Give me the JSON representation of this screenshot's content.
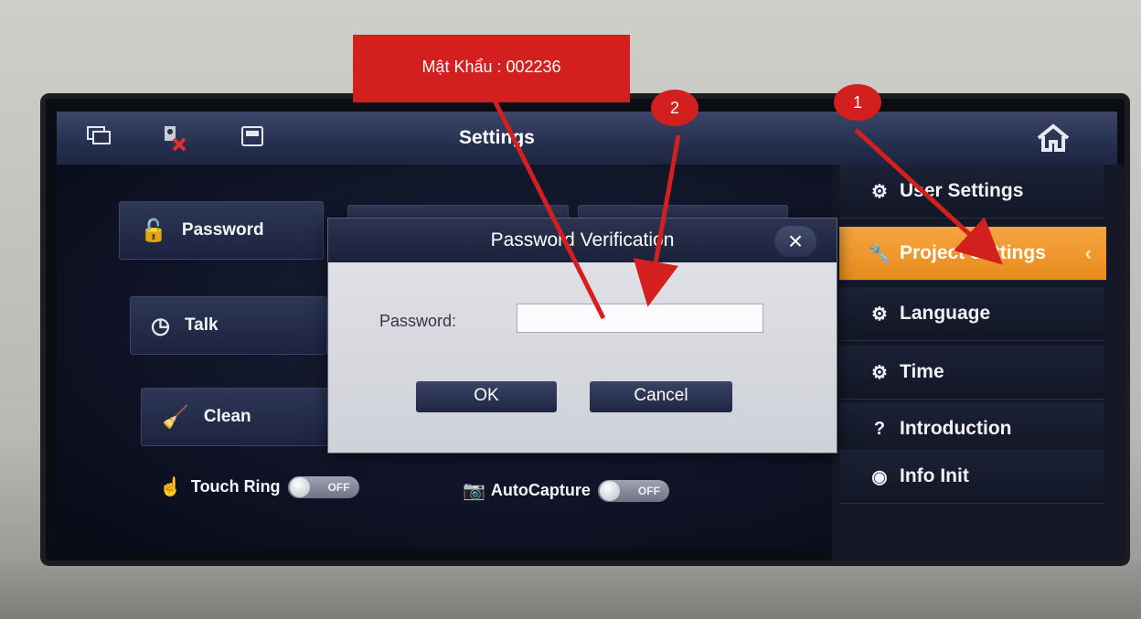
{
  "annotations": {
    "callout_text": "Mật Khẩu : 002236",
    "badge_1": "1",
    "badge_2": "2",
    "arrow_color": "#d41f1f"
  },
  "titlebar": {
    "title": "Settings",
    "icons": [
      "monitor-icon",
      "camera-offline-icon",
      "sd-card-icon",
      "home-icon"
    ]
  },
  "menu": {
    "password_label": "Password",
    "talk_label": "Talk",
    "clean_label": "Clean",
    "touch_ring_label": "Touch Ring",
    "touch_ring_state": "OFF",
    "autocapture_label": "AutoCapture",
    "autocapture_state": "OFF"
  },
  "sidebar": {
    "items": [
      {
        "label": "User Settings",
        "icon": "gear-icon",
        "active": false
      },
      {
        "label": "Project Settings",
        "icon": "wrench-icon",
        "active": true
      },
      {
        "label": "Language",
        "icon": "gear-icon",
        "active": false
      },
      {
        "label": "Time",
        "icon": "clock-gear-icon",
        "active": false
      },
      {
        "label": "Introduction",
        "icon": "question-icon",
        "active": false
      },
      {
        "label": "Info Init",
        "icon": "eye-icon",
        "active": false
      }
    ],
    "active_color": "#f0971f"
  },
  "dialog": {
    "title": "Password Verification",
    "password_label": "Password:",
    "password_value": "",
    "ok_label": "OK",
    "cancel_label": "Cancel"
  }
}
